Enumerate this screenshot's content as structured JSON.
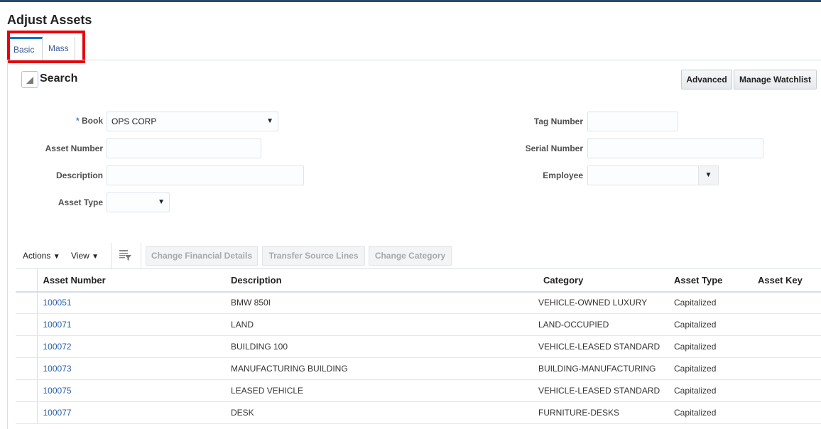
{
  "page": {
    "title": "Adjust Assets"
  },
  "tabs": [
    {
      "label": "Basic",
      "active": true
    },
    {
      "label": "Mass",
      "active": false
    }
  ],
  "search": {
    "heading": "Search",
    "advanced_label": "Advanced",
    "watchlist_label": "Manage Watchlist",
    "required_marker": "*",
    "book": {
      "label": "Book",
      "value": "OPS CORP"
    },
    "asset_number": {
      "label": "Asset Number",
      "value": ""
    },
    "description": {
      "label": "Description",
      "value": ""
    },
    "asset_type": {
      "label": "Asset Type",
      "value": ""
    },
    "tag_number": {
      "label": "Tag Number",
      "value": ""
    },
    "serial_number": {
      "label": "Serial Number",
      "value": ""
    },
    "employee": {
      "label": "Employee",
      "value": ""
    }
  },
  "toolbar": {
    "actions": "Actions",
    "view": "View",
    "change_financial": "Change Financial Details",
    "transfer_source": "Transfer Source Lines",
    "change_category": "Change Category"
  },
  "table": {
    "columns": [
      "Asset Number",
      "Description",
      "Category",
      "Asset Type",
      "Asset Key"
    ],
    "rows": [
      [
        "100051",
        "BMW 850I",
        "VEHICLE-OWNED LUXURY",
        "Capitalized",
        ""
      ],
      [
        "100071",
        "LAND",
        "LAND-OCCUPIED",
        "Capitalized",
        ""
      ],
      [
        "100072",
        "BUILDING 100",
        "VEHICLE-LEASED STANDARD",
        "Capitalized",
        ""
      ],
      [
        "100073",
        "MANUFACTURING BUILDING",
        "BUILDING-MANUFACTURING",
        "Capitalized",
        ""
      ],
      [
        "100075",
        "LEASED VEHICLE",
        "VEHICLE-LEASED STANDARD",
        "Capitalized",
        ""
      ],
      [
        "100077",
        "DESK",
        "FURNITURE-DESKS",
        "Capitalized",
        ""
      ]
    ]
  },
  "colors": {
    "accent": "#0572ce",
    "highlight": "#e8000b",
    "link": "#2960a8",
    "topbar": "#264a6e"
  }
}
